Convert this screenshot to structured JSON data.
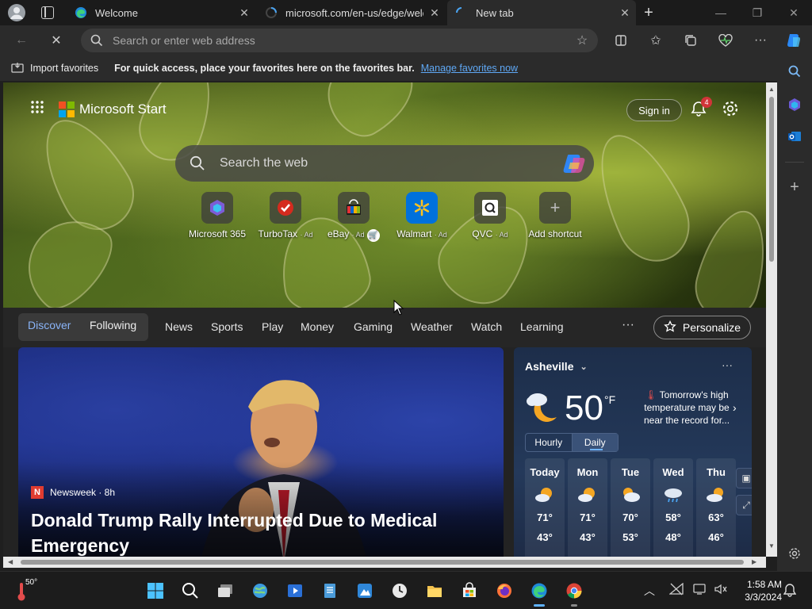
{
  "browser": {
    "tabs": [
      {
        "label": "Welcome",
        "icon": "edge-icon"
      },
      {
        "label": "microsoft.com/en-us/edge/welc",
        "icon": "loading-icon"
      },
      {
        "label": "New tab",
        "icon": "loading-icon"
      }
    ],
    "new_tab_label": "+",
    "address_placeholder": "Search or enter web address"
  },
  "favorites_bar": {
    "import_label": "Import favorites",
    "message": "For quick access, place your favorites here on the favorites bar.",
    "manage_link": "Manage favorites now"
  },
  "start_page": {
    "brand": "Microsoft Start",
    "sign_in": "Sign in",
    "notification_count": "4",
    "search_placeholder": "Search the web",
    "shortcuts": [
      {
        "label": "Microsoft 365",
        "ad": ""
      },
      {
        "label": "TurboTax",
        "ad": "· Ad"
      },
      {
        "label": "eBay",
        "ad": "· Ad"
      },
      {
        "label": "Walmart",
        "ad": "· Ad"
      },
      {
        "label": "QVC",
        "ad": "· Ad"
      },
      {
        "label": "Add shortcut",
        "ad": ""
      }
    ],
    "nav": {
      "discover": "Discover",
      "following": "Following",
      "links": [
        "News",
        "Sports",
        "Play",
        "Money",
        "Gaming",
        "Weather",
        "Watch",
        "Learning"
      ],
      "more": "···",
      "personalize": "Personalize"
    },
    "news": {
      "source": "Newsweek · 8h",
      "source_logo": "N",
      "headline": "Donald Trump Rally Interrupted Due to Medical Emergency"
    },
    "weather": {
      "city": "Asheville",
      "temp": "50",
      "unit": "°F",
      "note": "Tomorrow's high temperature may be near the record for...",
      "toggle_hourly": "Hourly",
      "toggle_daily": "Daily",
      "days": [
        {
          "day": "Today",
          "hi": "71°",
          "lo": "43°"
        },
        {
          "day": "Mon",
          "hi": "71°",
          "lo": "43°"
        },
        {
          "day": "Tue",
          "hi": "70°",
          "lo": "53°"
        },
        {
          "day": "Wed",
          "hi": "58°",
          "lo": "48°"
        },
        {
          "day": "Thu",
          "hi": "63°",
          "lo": "46°"
        }
      ]
    }
  },
  "taskbar": {
    "weather_temp": "50°",
    "time": "1:58 AM",
    "date": "3/3/2024"
  },
  "colors": {
    "accent_link": "#5fa8f5",
    "discover_active": "#8ab4f8",
    "badge": "#d13438"
  }
}
